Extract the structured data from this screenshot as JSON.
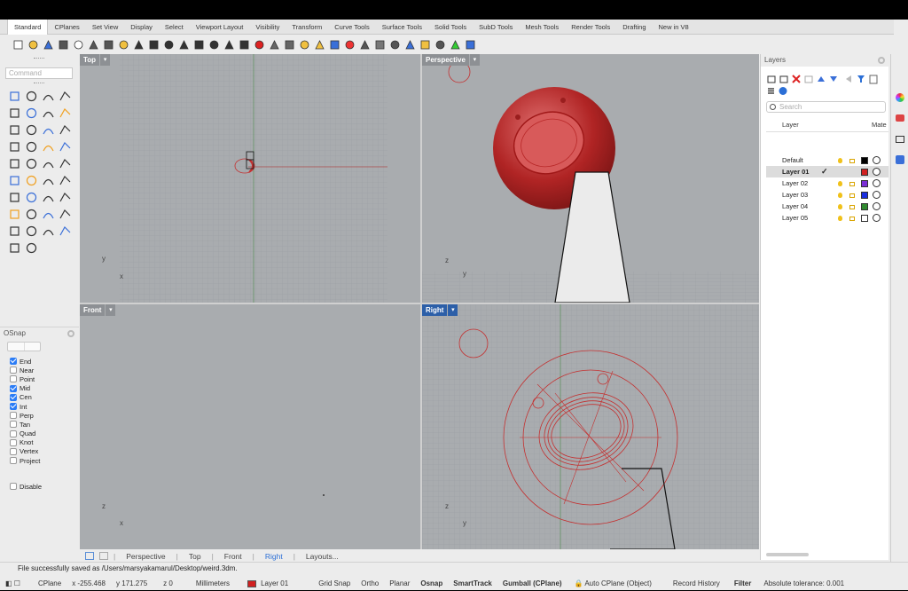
{
  "menu_tabs": [
    "Standard",
    "CPlanes",
    "Set View",
    "Display",
    "Select",
    "Viewport Layout",
    "Visibility",
    "Transform",
    "Curve Tools",
    "Surface Tools",
    "Solid Tools",
    "SubD Tools",
    "Mesh Tools",
    "Render Tools",
    "Drafting",
    "New in V8"
  ],
  "active_tab": "Standard",
  "command": {
    "placeholder": "Command"
  },
  "osnap": {
    "title": "OSnap",
    "items": [
      {
        "label": "End",
        "checked": true
      },
      {
        "label": "Near",
        "checked": false
      },
      {
        "label": "Point",
        "checked": false
      },
      {
        "label": "Mid",
        "checked": true
      },
      {
        "label": "Cen",
        "checked": true
      },
      {
        "label": "Int",
        "checked": true
      },
      {
        "label": "Perp",
        "checked": false
      },
      {
        "label": "Tan",
        "checked": false
      },
      {
        "label": "Quad",
        "checked": false
      },
      {
        "label": "Knot",
        "checked": false
      },
      {
        "label": "Vertex",
        "checked": false
      },
      {
        "label": "Project",
        "checked": false
      }
    ],
    "disable_label": "Disable"
  },
  "viewports": {
    "top": {
      "name": "Top",
      "axis_y": "y",
      "axis_x": "x"
    },
    "perspective": {
      "name": "Perspective",
      "axis_y": "z",
      "axis_x": "y"
    },
    "front": {
      "name": "Front",
      "axis_y": "z",
      "axis_x": "x"
    },
    "right": {
      "name": "Right",
      "axis_y": "z",
      "axis_x": "y"
    }
  },
  "viewport_tabs": [
    "Perspective",
    "Top",
    "Front",
    "Right",
    "Layouts..."
  ],
  "selected_viewport_tab": "Right",
  "layers": {
    "title": "Layers",
    "search_placeholder": "Search",
    "col_layer": "Layer",
    "col_material": "Mate",
    "rows": [
      {
        "name": "Default",
        "color": "#000000",
        "current": false
      },
      {
        "name": "Layer 01",
        "color": "#d12020",
        "current": true
      },
      {
        "name": "Layer 02",
        "color": "#7b2fd6",
        "current": false
      },
      {
        "name": "Layer 03",
        "color": "#1a2fe0",
        "current": false
      },
      {
        "name": "Layer 04",
        "color": "#2f8a2f",
        "current": false
      },
      {
        "name": "Layer 05",
        "color": "#ffffff",
        "current": false
      }
    ],
    "current_mark": "✓"
  },
  "status": {
    "message": "File successfully saved as /Users/marsyakamarul/Desktop/weird.3dm.",
    "cplane": "CPlane",
    "x": "x -255.468",
    "y": "y 171.275",
    "z": "z 0",
    "units": "Millimeters",
    "layer": "Layer 01",
    "layer_color": "#d12020",
    "toggles": [
      "Grid Snap",
      "Ortho",
      "Planar",
      "Osnap",
      "SmartTrack",
      "Gumball (CPlane)"
    ],
    "bold_toggles": [
      "Osnap",
      "SmartTrack",
      "Gumball (CPlane)"
    ],
    "auto_cplane": "Auto CPlane (Object)",
    "record_history": "Record History",
    "filter": "Filter",
    "tolerance": "Absolute tolerance: 0.001"
  }
}
